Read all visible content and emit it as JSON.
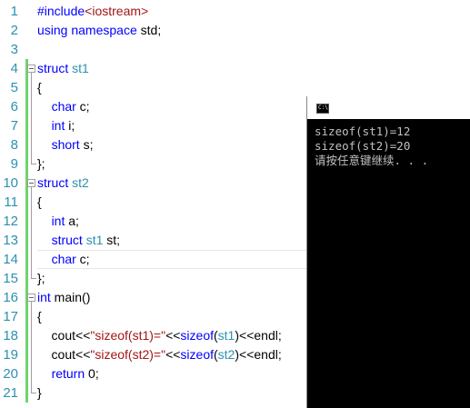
{
  "editor": {
    "line_numbers": [
      "1",
      "2",
      "3",
      "4",
      "5",
      "6",
      "7",
      "8",
      "9",
      "10",
      "11",
      "12",
      "13",
      "14",
      "15",
      "16",
      "17",
      "18",
      "19",
      "20",
      "21"
    ],
    "lines": [
      [
        {
          "c": "pp",
          "t": "#include"
        },
        {
          "c": "inc",
          "t": "<iostream>"
        }
      ],
      [
        {
          "c": "kw",
          "t": "using"
        },
        {
          "c": "",
          "t": " "
        },
        {
          "c": "kw",
          "t": "namespace"
        },
        {
          "c": "",
          "t": " std;"
        }
      ],
      [],
      [
        {
          "c": "kw",
          "t": "struct"
        },
        {
          "c": "",
          "t": " "
        },
        {
          "c": "ty",
          "t": "st1"
        }
      ],
      [
        {
          "c": "",
          "t": "{"
        }
      ],
      [
        {
          "c": "",
          "t": "    "
        },
        {
          "c": "kw",
          "t": "char"
        },
        {
          "c": "",
          "t": " c;"
        }
      ],
      [
        {
          "c": "",
          "t": "    "
        },
        {
          "c": "kw",
          "t": "int"
        },
        {
          "c": "",
          "t": " i;"
        }
      ],
      [
        {
          "c": "",
          "t": "    "
        },
        {
          "c": "kw",
          "t": "short"
        },
        {
          "c": "",
          "t": " s;"
        }
      ],
      [
        {
          "c": "",
          "t": "};"
        }
      ],
      [
        {
          "c": "kw",
          "t": "struct"
        },
        {
          "c": "",
          "t": " "
        },
        {
          "c": "ty",
          "t": "st2"
        }
      ],
      [
        {
          "c": "",
          "t": "{"
        }
      ],
      [
        {
          "c": "",
          "t": "    "
        },
        {
          "c": "kw",
          "t": "int"
        },
        {
          "c": "",
          "t": " a;"
        }
      ],
      [
        {
          "c": "",
          "t": "    "
        },
        {
          "c": "kw",
          "t": "struct"
        },
        {
          "c": "",
          "t": " "
        },
        {
          "c": "ty",
          "t": "st1"
        },
        {
          "c": "",
          "t": " st;"
        }
      ],
      [
        {
          "c": "",
          "t": "    "
        },
        {
          "c": "kw",
          "t": "char"
        },
        {
          "c": "",
          "t": " c;"
        }
      ],
      [
        {
          "c": "",
          "t": "};"
        }
      ],
      [
        {
          "c": "kw",
          "t": "int"
        },
        {
          "c": "",
          "t": " main()"
        }
      ],
      [
        {
          "c": "",
          "t": "{"
        }
      ],
      [
        {
          "c": "",
          "t": "    cout<<"
        },
        {
          "c": "str",
          "t": "\"sizeof(st1)=\""
        },
        {
          "c": "",
          "t": "<<"
        },
        {
          "c": "kw",
          "t": "sizeof"
        },
        {
          "c": "",
          "t": "("
        },
        {
          "c": "ty",
          "t": "st1"
        },
        {
          "c": "",
          "t": ")<<endl;"
        }
      ],
      [
        {
          "c": "",
          "t": "    cout<<"
        },
        {
          "c": "str",
          "t": "\"sizeof(st2)=\""
        },
        {
          "c": "",
          "t": "<<"
        },
        {
          "c": "kw",
          "t": "sizeof"
        },
        {
          "c": "",
          "t": "("
        },
        {
          "c": "ty",
          "t": "st2"
        },
        {
          "c": "",
          "t": ")<<endl;"
        }
      ],
      [
        {
          "c": "",
          "t": "    "
        },
        {
          "c": "kw",
          "t": "return"
        },
        {
          "c": "",
          "t": " 0;"
        }
      ],
      [
        {
          "c": "",
          "t": "}"
        }
      ]
    ]
  },
  "console": {
    "icon_label": "C:\\.",
    "output": [
      "sizeof(st1)=12",
      "sizeof(st2)=20",
      "请按任意键继续. . ."
    ]
  },
  "colors": {
    "keyword": "#0000ff",
    "string": "#a31515",
    "type": "#2b91af",
    "line_number": "#2b91af",
    "change_bar": "#6ed36e",
    "console_bg": "#000000",
    "console_fg": "#c0c0c0"
  }
}
